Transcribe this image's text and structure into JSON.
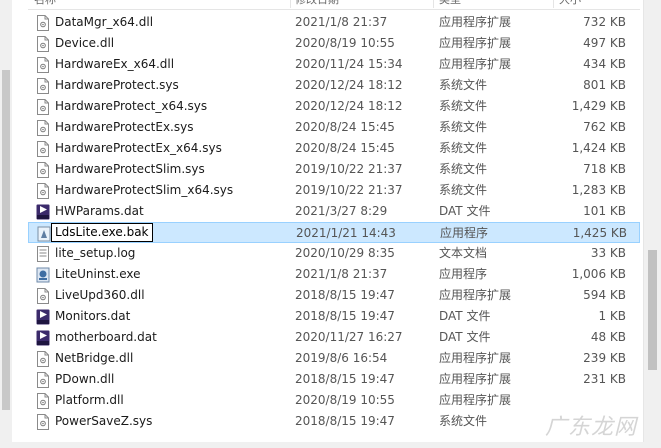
{
  "columns": {
    "name": "名称",
    "date": "修改日期",
    "type": "类型",
    "size": "大小"
  },
  "files": [
    {
      "name": "DataMgr_x64.dll",
      "date": "2021/1/8 21:37",
      "type": "应用程序扩展",
      "size": "732 KB",
      "icon": "dll-icon"
    },
    {
      "name": "Device.dll",
      "date": "2020/8/19 10:55",
      "type": "应用程序扩展",
      "size": "497 KB",
      "icon": "dll-icon"
    },
    {
      "name": "HardwareEx_x64.dll",
      "date": "2020/11/24 15:34",
      "type": "应用程序扩展",
      "size": "434 KB",
      "icon": "dll-icon"
    },
    {
      "name": "HardwareProtect.sys",
      "date": "2020/12/24 18:12",
      "type": "系统文件",
      "size": "801 KB",
      "icon": "sys-icon"
    },
    {
      "name": "HardwareProtect_x64.sys",
      "date": "2020/12/24 18:12",
      "type": "系统文件",
      "size": "1,429 KB",
      "icon": "sys-icon"
    },
    {
      "name": "HardwareProtectEx.sys",
      "date": "2020/8/24 15:45",
      "type": "系统文件",
      "size": "762 KB",
      "icon": "sys-icon"
    },
    {
      "name": "HardwareProtectEx_x64.sys",
      "date": "2020/8/24 15:45",
      "type": "系统文件",
      "size": "1,424 KB",
      "icon": "sys-icon"
    },
    {
      "name": "HardwareProtectSlim.sys",
      "date": "2019/10/22 21:37",
      "type": "系统文件",
      "size": "718 KB",
      "icon": "sys-icon"
    },
    {
      "name": "HardwareProtectSlim_x64.sys",
      "date": "2019/10/22 21:37",
      "type": "系统文件",
      "size": "1,283 KB",
      "icon": "sys-icon"
    },
    {
      "name": "HWParams.dat",
      "date": "2021/3/27 8:29",
      "type": "DAT 文件",
      "size": "101 KB",
      "icon": "dat-icon"
    },
    {
      "name": "LdsLite.exe.bak",
      "date": "2021/1/21 14:43",
      "type": "应用程序",
      "size": "1,425 KB",
      "icon": "exe-icon",
      "selected": true
    },
    {
      "name": "lite_setup.log",
      "date": "2020/10/29 8:35",
      "type": "文本文档",
      "size": "33 KB",
      "icon": "log-icon"
    },
    {
      "name": "LiteUninst.exe",
      "date": "2021/1/8 21:37",
      "type": "应用程序",
      "size": "1,006 KB",
      "icon": "uninstall-icon"
    },
    {
      "name": "LiveUpd360.dll",
      "date": "2018/8/15 19:47",
      "type": "应用程序扩展",
      "size": "594 KB",
      "icon": "dll-icon"
    },
    {
      "name": "Monitors.dat",
      "date": "2018/8/15 19:47",
      "type": "DAT 文件",
      "size": "1 KB",
      "icon": "dat-icon"
    },
    {
      "name": "motherboard.dat",
      "date": "2020/11/27 16:27",
      "type": "DAT 文件",
      "size": "48 KB",
      "icon": "dat-icon"
    },
    {
      "name": "NetBridge.dll",
      "date": "2019/8/6 16:54",
      "type": "应用程序扩展",
      "size": "239 KB",
      "icon": "dll-icon"
    },
    {
      "name": "PDown.dll",
      "date": "2018/8/15 19:47",
      "type": "应用程序扩展",
      "size": "231 KB",
      "icon": "dll-icon"
    },
    {
      "name": "Platform.dll",
      "date": "2020/8/19 10:55",
      "type": "应用程序扩展",
      "size": "",
      "icon": "dll-icon"
    },
    {
      "name": "PowerSaveZ.sys",
      "date": "2018/8/15 19:47",
      "type": "系统文件",
      "size": "",
      "icon": "sys-icon"
    }
  ],
  "watermark": "广东龙网",
  "colors": {
    "selection_bg": "#cce8ff",
    "selection_border": "#99d1ff",
    "dat_badge": "#3b2a6b"
  }
}
